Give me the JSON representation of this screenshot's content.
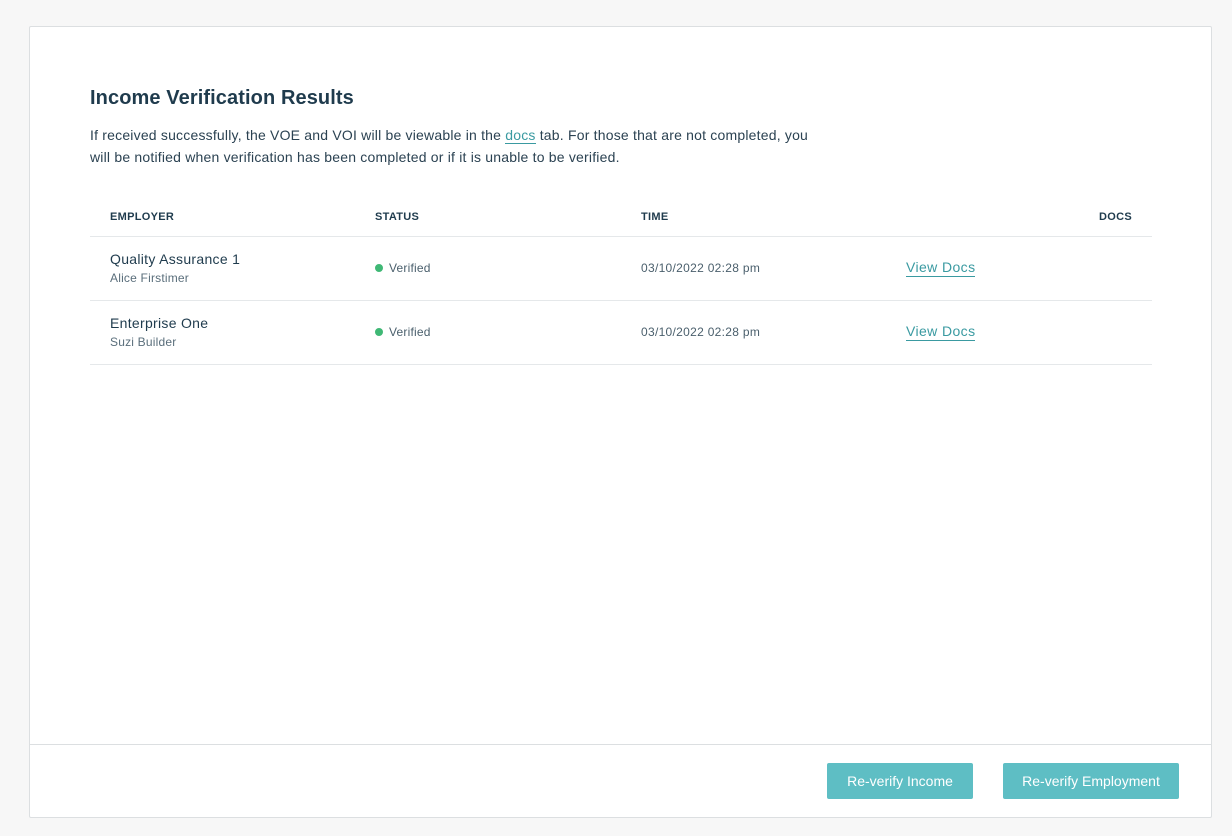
{
  "page": {
    "title": "Income Verification Results",
    "description_before": "If received successfully, the VOE and VOI will be viewable in the ",
    "description_link": "docs",
    "description_after": " tab. For those that are not completed, you will be notified when verification has been completed or if it is unable to be verified."
  },
  "table": {
    "headers": {
      "employer": "EMPLOYER",
      "status": "STATUS",
      "time": "TIME",
      "docs": "DOCS"
    },
    "rows": [
      {
        "employer": "Quality Assurance 1",
        "person": "Alice Firstimer",
        "status": "Verified",
        "time": "03/10/2022 02:28 pm",
        "docs_link": "View Docs"
      },
      {
        "employer": "Enterprise One",
        "person": "Suzi Builder",
        "status": "Verified",
        "time": "03/10/2022 02:28 pm",
        "docs_link": "View Docs"
      }
    ]
  },
  "footer": {
    "reverify_income_label": "Re-verify Income",
    "reverify_employment_label": "Re-verify Employment"
  },
  "colors": {
    "accent": "#5ebec4",
    "link": "#3a9aa1",
    "status_verified": "#3fb875",
    "text": "#1f3b4d"
  }
}
